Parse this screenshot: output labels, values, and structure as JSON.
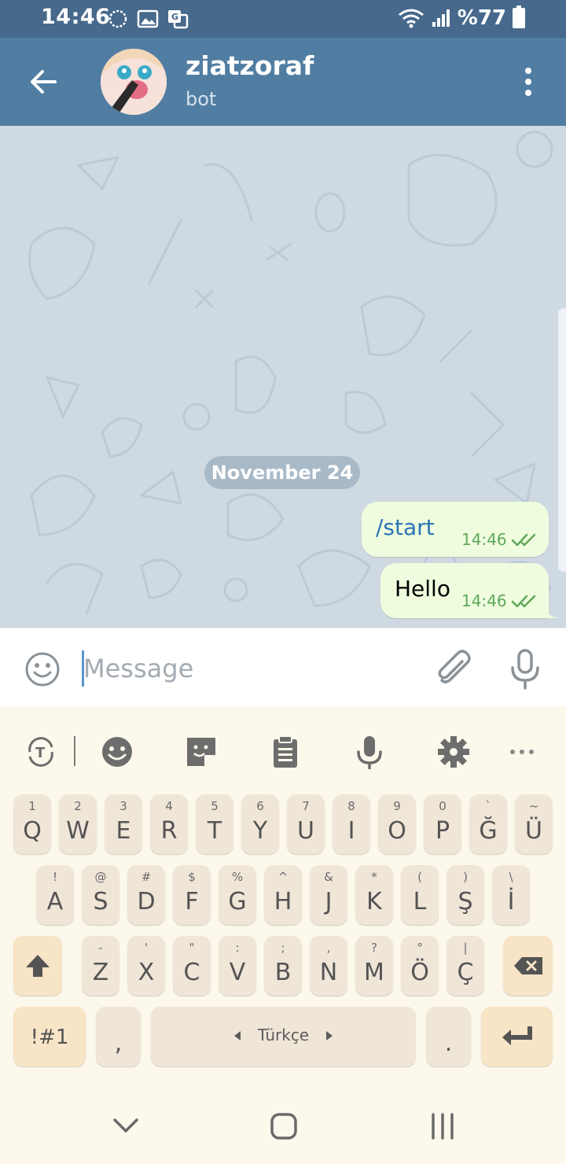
{
  "status_bar": {
    "time": "14:46",
    "battery": "%77",
    "icons": [
      "sync-icon",
      "image-icon",
      "translate-icon",
      "wifi-icon",
      "signal-icon",
      "battery-icon"
    ]
  },
  "header": {
    "title": "ziatzoraf",
    "subtitle": "bot",
    "background": "#517da2"
  },
  "chat": {
    "date_label": "November 24",
    "messages": [
      {
        "text": "/start",
        "time": "14:46",
        "status": "read"
      },
      {
        "text": "Hello",
        "time": "14:46",
        "status": "read"
      }
    ]
  },
  "compose": {
    "placeholder": "Message"
  },
  "keyboard": {
    "row1": [
      {
        "main": "Q",
        "sub": "1"
      },
      {
        "main": "W",
        "sub": "2"
      },
      {
        "main": "E",
        "sub": "3"
      },
      {
        "main": "R",
        "sub": "4"
      },
      {
        "main": "T",
        "sub": "5"
      },
      {
        "main": "Y",
        "sub": "6"
      },
      {
        "main": "U",
        "sub": "7"
      },
      {
        "main": "I",
        "sub": "8"
      },
      {
        "main": "O",
        "sub": "9"
      },
      {
        "main": "P",
        "sub": "0"
      },
      {
        "main": "Ğ",
        "sub": "`"
      },
      {
        "main": "Ü",
        "sub": "~"
      }
    ],
    "row2": [
      {
        "main": "A",
        "sub": "!"
      },
      {
        "main": "S",
        "sub": "@"
      },
      {
        "main": "D",
        "sub": "#"
      },
      {
        "main": "F",
        "sub": "$"
      },
      {
        "main": "G",
        "sub": "%"
      },
      {
        "main": "H",
        "sub": "^"
      },
      {
        "main": "J",
        "sub": "&"
      },
      {
        "main": "K",
        "sub": "*"
      },
      {
        "main": "L",
        "sub": "("
      },
      {
        "main": "Ş",
        "sub": ")"
      },
      {
        "main": "İ",
        "sub": "\\"
      }
    ],
    "row3": [
      {
        "main": "Z",
        "sub": "-"
      },
      {
        "main": "X",
        "sub": "'"
      },
      {
        "main": "C",
        "sub": "\""
      },
      {
        "main": "V",
        "sub": ":"
      },
      {
        "main": "B",
        "sub": ";"
      },
      {
        "main": "N",
        "sub": ","
      },
      {
        "main": "M",
        "sub": "?"
      },
      {
        "main": "Ö",
        "sub": "°"
      },
      {
        "main": "Ç",
        "sub": "|"
      }
    ],
    "symbols_label": "!#1",
    "comma": ",",
    "space_label": "Türkçe",
    "period": "."
  }
}
